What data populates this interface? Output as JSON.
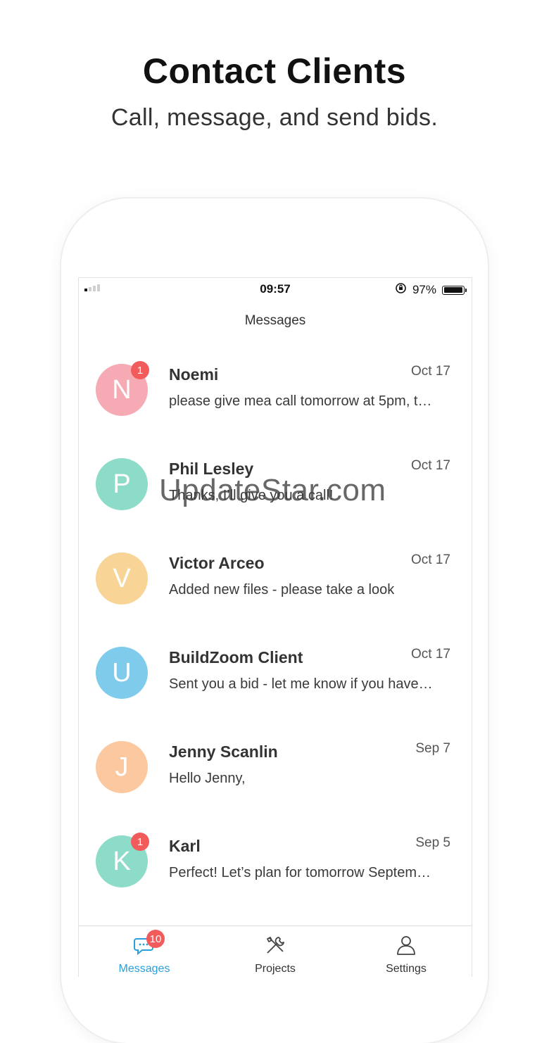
{
  "header": {
    "title": "Contact Clients",
    "subtitle": "Call, message, and send bids."
  },
  "status_bar": {
    "time": "09:57",
    "battery": "97%",
    "battery_level": 0.97,
    "signal_bars": 1
  },
  "nav": {
    "title": "Messages"
  },
  "conversations": [
    {
      "initial": "N",
      "name": "Noemi",
      "date": "Oct 17",
      "preview": "please give mea call tomorrow at 5pm, t…",
      "badge": "1",
      "color": "#f6aab4"
    },
    {
      "initial": "P",
      "name": "Phil Lesley",
      "date": "Oct 17",
      "preview": "Thanks, I’ll give you a call!",
      "badge": "",
      "color": "#8ddcc9"
    },
    {
      "initial": "V",
      "name": "Victor Arceo",
      "date": "Oct 17",
      "preview": "Added new files - please take a look",
      "badge": "",
      "color": "#f8d596"
    },
    {
      "initial": "U",
      "name": "BuildZoom Client",
      "date": "Oct 17",
      "preview": "Sent you a bid - let me know if you have…",
      "badge": "",
      "color": "#7ecbec"
    },
    {
      "initial": "J",
      "name": "Jenny Scanlin",
      "date": "Sep 7",
      "preview": "Hello Jenny,",
      "badge": "",
      "color": "#fcc8a0"
    },
    {
      "initial": "K",
      "name": "Karl",
      "date": "Sep 5",
      "preview": "Perfect! Let’s plan for tomorrow Septem…",
      "badge": "1",
      "color": "#8ddcc9"
    }
  ],
  "tabs": [
    {
      "label": "Messages",
      "icon": "chat-bubble-icon",
      "badge": "10",
      "active": true
    },
    {
      "label": "Projects",
      "icon": "tools-icon",
      "badge": "",
      "active": false
    },
    {
      "label": "Settings",
      "icon": "person-icon",
      "badge": "",
      "active": false
    }
  ],
  "watermark": "UpdateStar.com",
  "colors": {
    "accent": "#2a9fd8",
    "badge": "#f25b5b"
  }
}
